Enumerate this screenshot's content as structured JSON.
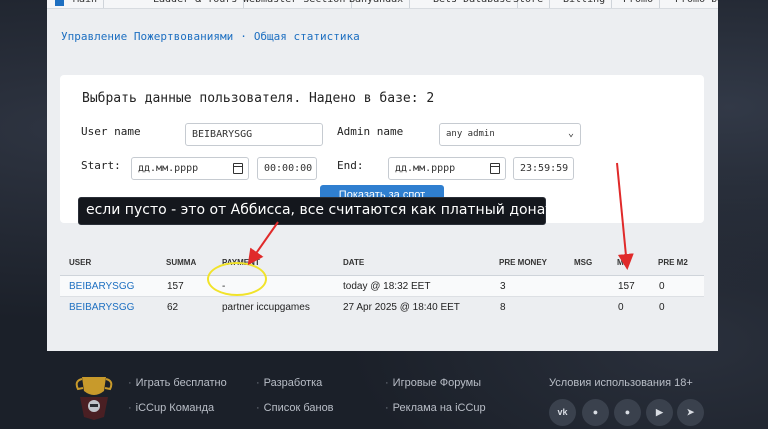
{
  "topnav": {
    "tabs": [
      "Main",
      "Ladder & Tours",
      "Webmaster Section",
      "Banyandax",
      "Bets Database",
      "Store",
      "Billing",
      "Promo",
      "Promo background"
    ]
  },
  "breadcrumb": {
    "items": [
      "Управление Пожертвованиями",
      "Общая статистика"
    ],
    "separator": "·"
  },
  "filter": {
    "title": "Выбрать данные пользователя. Надено в базе: 2",
    "user_name_label": "User name",
    "user_name_value": "BEIBARYSGG",
    "admin_name_label": "Admin name",
    "admin_name_value": "any admin",
    "start_label": "Start:",
    "start_date_placeholder": "дд.мм.рррр",
    "start_time": "00:00:00",
    "end_label": "End:",
    "end_date_placeholder": "дд.мм.рррр",
    "end_time": "23:59:59",
    "search_button": "Показать за спот"
  },
  "annotation": {
    "text": "если пусто - это от Аббисса, все считаются как платный донат",
    "arrow_color": "#e02a2a",
    "circle_color": "#f1e32a"
  },
  "table": {
    "columns": [
      "USER",
      "SUMMA",
      "PAYMENT",
      "DATE",
      "PRE MONEY",
      "MSG",
      "M2",
      "PRE M2"
    ],
    "rows": [
      {
        "user": "BEIBARYSGG",
        "summa": "157",
        "payment": "-",
        "date": "today @ 18:32 EET",
        "pre_money": "3",
        "msg": "",
        "m2": "157",
        "pre_m2": "0"
      },
      {
        "user": "BEIBARYSGG",
        "summa": "62",
        "payment": "partner iccupgames",
        "date": "27 Apr 2025 @ 18:40 EET",
        "pre_money": "8",
        "msg": "",
        "m2": "0",
        "pre_m2": "0"
      }
    ]
  },
  "footer": {
    "col1": [
      "Играть бесплатно",
      "iCCup Команда"
    ],
    "col2": [
      "Разработка",
      "Список банов"
    ],
    "col3": [
      "Игровые Форумы",
      "Реклама на iCCup"
    ],
    "age_text": "Условия использования 18+",
    "social": [
      "vk-icon",
      "discord-icon",
      "discord-icon",
      "youtube-icon",
      "telegram-icon"
    ]
  },
  "colors": {
    "accent": "#1d6fc1",
    "button": "#2f7fd0",
    "background": "#1b2029"
  }
}
